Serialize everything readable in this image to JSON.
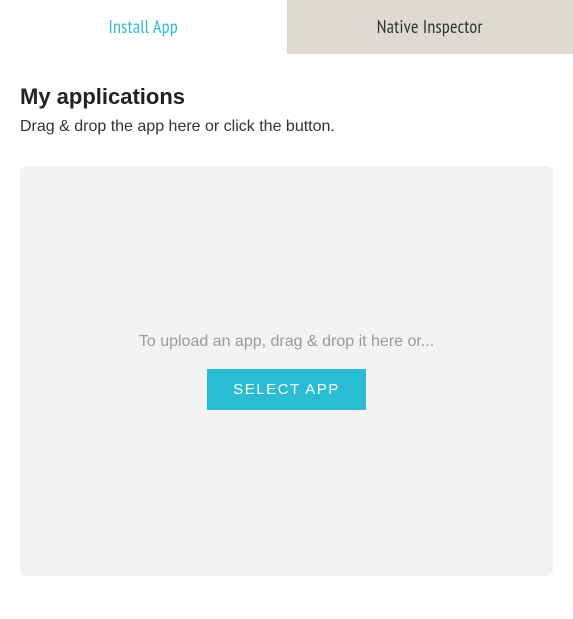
{
  "tabs": {
    "install": "Install App",
    "inspector": "Native Inspector"
  },
  "heading": "My applications",
  "subheading": "Drag & drop the app here or click the button.",
  "dropzone": {
    "hint": "To upload an app, drag & drop it here or...",
    "button": "SELECT APP"
  }
}
